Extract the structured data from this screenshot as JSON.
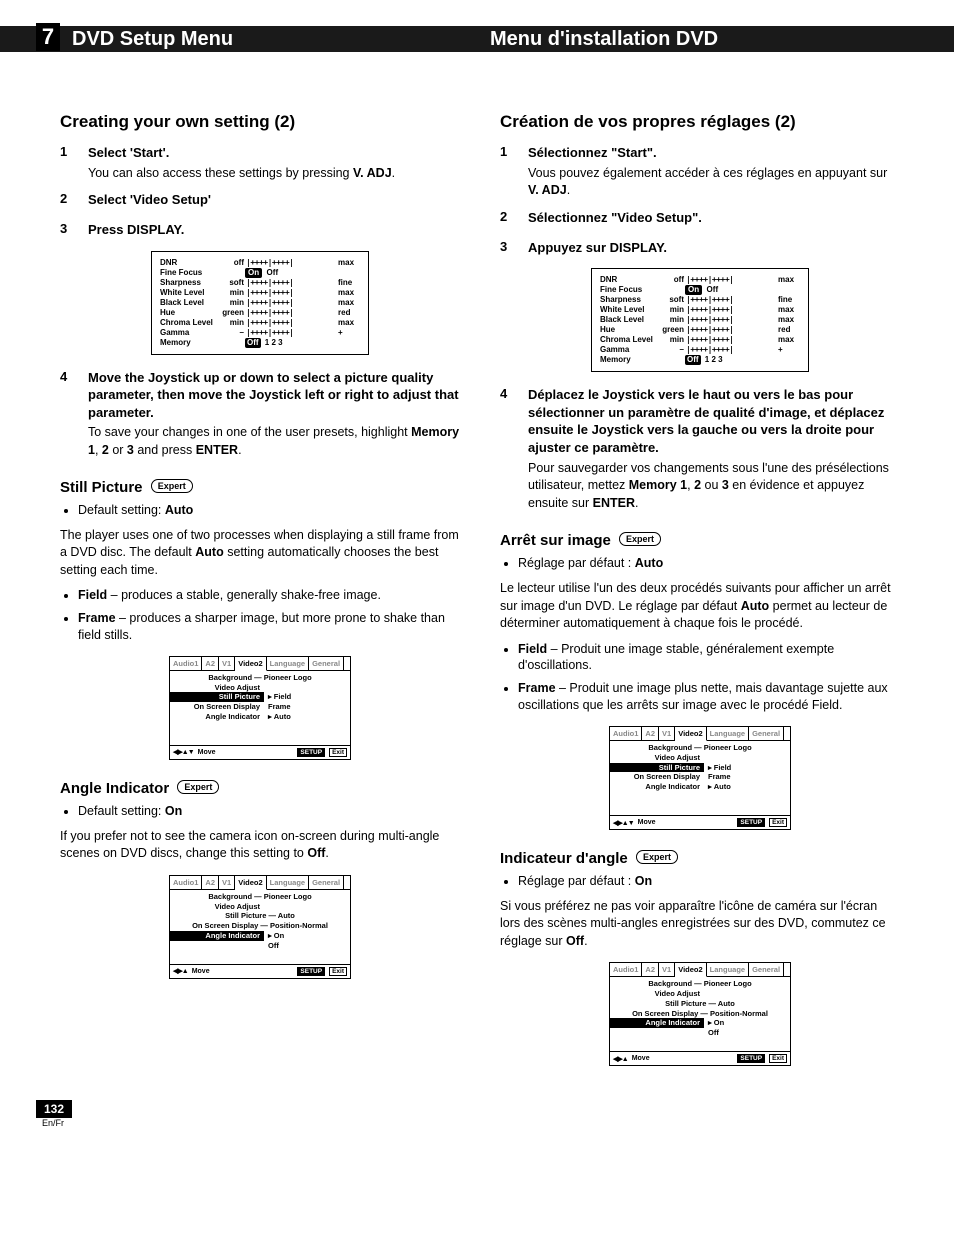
{
  "chapter_number": "7",
  "header": {
    "left": "DVD Setup Menu",
    "right": "Menu d'installation DVD"
  },
  "expert_label": "Expert",
  "page_number": "132",
  "lang_tag": "En/Fr",
  "adj_panel": {
    "rows": [
      {
        "label": "DNR",
        "l": "off",
        "r": "max"
      },
      {
        "label": "Fine Focus",
        "type": "onoff",
        "on": "On",
        "off": "Off"
      },
      {
        "label": "Sharpness",
        "l": "soft",
        "r": "fine"
      },
      {
        "label": "White Level",
        "l": "min",
        "r": "max"
      },
      {
        "label": "Black Level",
        "l": "min",
        "r": "max"
      },
      {
        "label": "Hue",
        "l": "green",
        "r": "red"
      },
      {
        "label": "Chroma Level",
        "l": "min",
        "r": "max"
      },
      {
        "label": "Gamma",
        "l": "–",
        "r": "+"
      },
      {
        "label": "Memory",
        "type": "mem",
        "off": "Off",
        "nums": "1   2   3"
      }
    ],
    "slider": "|++++|++++|"
  },
  "osd": {
    "tabs": [
      "Audio1",
      "A2",
      "V1",
      "Video2",
      "Language",
      "General"
    ],
    "active_tab_index": 3,
    "move": "Move",
    "setup": "SETUP",
    "exit": "Exit",
    "arrows": "◀▶▲▼",
    "arrows_short": "◀▶▲"
  },
  "osd_a": {
    "lines": [
      {
        "center": true,
        "text": "Background — Pioneer Logo"
      },
      {
        "ll": "Video Adjust",
        "rr": ""
      },
      {
        "ll": "Still Picture",
        "rr": "Field",
        "hl": true,
        "lead": "▸"
      },
      {
        "ll": "On Screen Display",
        "rr": "Frame"
      },
      {
        "ll": "Angle Indicator",
        "rr": "Auto",
        "lead": "▸"
      }
    ]
  },
  "osd_b": {
    "lines": [
      {
        "center": true,
        "text": "Background — Pioneer Logo"
      },
      {
        "ll": "Video Adjust",
        "rr": ""
      },
      {
        "center": true,
        "text": "Still Picture — Auto"
      },
      {
        "center": true,
        "text": "On Screen Display — Position-Normal"
      },
      {
        "ll": "Angle Indicator",
        "rr": "On",
        "hl": true,
        "lead": "▸"
      },
      {
        "ll": "",
        "rr": "Off"
      }
    ]
  },
  "en": {
    "h2": "Creating your own setting (2)",
    "steps": [
      {
        "n": "1",
        "title": "Select 'Start'.",
        "text_pre": "You can also access these settings by pressing ",
        "text_b": "V. ADJ",
        "text_post": "."
      },
      {
        "n": "2",
        "title": "Select 'Video Setup'"
      },
      {
        "n": "3",
        "title": "Press DISPLAY."
      },
      {
        "n": "4",
        "title": "Move the Joystick up or down to select a picture quality parameter, then move the Joystick left or right to adjust that parameter.",
        "text_pre": "To save your changes in one of the user presets, highlight ",
        "text_b": "Memory 1",
        "text_mid": ", ",
        "text_b2": "2",
        "text_mid2": " or ",
        "text_b3": "3",
        "text_mid3": " and press ",
        "text_b4": "ENTER",
        "text_post": "."
      }
    ],
    "still": {
      "title": "Still Picture",
      "default_label": "Default setting: ",
      "default_value": "Auto",
      "intro_pre": "The player uses one of two processes when displaying a still frame from a DVD disc. The default ",
      "intro_b": "Auto",
      "intro_post": " setting automatically chooses the best setting each time.",
      "field_b": "Field",
      "field_t": " – produces a stable, generally shake-free image.",
      "frame_b": "Frame",
      "frame_t": " – produces a sharper image, but more prone to shake than field stills."
    },
    "angle": {
      "title": "Angle Indicator",
      "default_label": "Default setting: ",
      "default_value": "On",
      "text_pre": "If you prefer not to see the camera icon on-screen during multi-angle scenes on DVD discs, change this setting to ",
      "text_b": "Off",
      "text_post": "."
    }
  },
  "fr": {
    "h2": "Création de vos propres réglages (2)",
    "steps": [
      {
        "n": "1",
        "title": "Sélectionnez \"Start\".",
        "text_pre": "Vous pouvez également accéder à ces réglages en appuyant sur ",
        "text_b": "V. ADJ",
        "text_post": "."
      },
      {
        "n": "2",
        "title": "Sélectionnez \"Video Setup\"."
      },
      {
        "n": "3",
        "title": "Appuyez sur DISPLAY."
      },
      {
        "n": "4",
        "title": "Déplacez le Joystick vers le haut ou vers le bas pour sélectionner un paramètre de qualité d'image, et déplacez ensuite le Joystick vers la gauche ou vers la droite pour ajuster ce paramètre.",
        "text_pre": "Pour sauvegarder vos changements sous l'une des présélections utilisateur, mettez ",
        "text_b": "Memory 1",
        "text_mid": ", ",
        "text_b2": "2",
        "text_mid2": " ou ",
        "text_b3": "3",
        "text_mid3": " en évidence et appuyez ensuite sur ",
        "text_b4": "ENTER",
        "text_post": "."
      }
    ],
    "still": {
      "title": "Arrêt sur image",
      "default_label": "Réglage par défaut : ",
      "default_value": "Auto",
      "intro_pre": "Le lecteur utilise l'un des deux procédés suivants pour afficher un arrêt sur image d'un DVD. Le réglage par défaut ",
      "intro_b": "Auto",
      "intro_post": " permet au lecteur de déterminer automatiquement à chaque fois le procédé.",
      "field_b": "Field",
      "field_t": " – Produit une image stable, généralement exempte d'oscillations.",
      "frame_b": "Frame",
      "frame_t": " – Produit une image plus nette, mais davantage sujette aux oscillations que les arrêts sur image avec le procédé Field."
    },
    "angle": {
      "title": "Indicateur d'angle",
      "default_label": "Réglage par défaut : ",
      "default_value": "On",
      "text_pre": "Si vous préférez ne pas voir apparaître l'icône de caméra sur l'écran lors des scènes multi-angles enregistrées sur des DVD, commutez ce réglage sur ",
      "text_b": "Off",
      "text_post": "."
    }
  }
}
